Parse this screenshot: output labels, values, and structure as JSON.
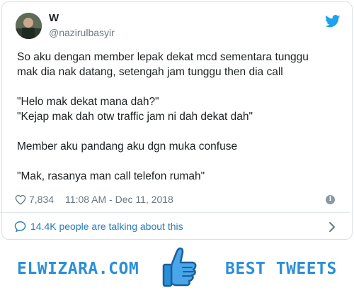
{
  "tweet": {
    "display_name": "W",
    "handle": "@nazirulbasyir",
    "text": "So aku dengan member lepak dekat mcd sementara tunggu\nmak dia nak datang, setengah jam tunggu then dia call\n\n\"Helo mak dekat mana dah?\"\n\"Kejap mak dah otw traffic jam ni dah dekat dah\"\n\nMember aku pandang aku dgn muka confuse\n\n\"Mak, rasanya man call telefon rumah\"",
    "likes": "7,834",
    "timestamp": "11:08 AM - Dec 11, 2018",
    "talking": "14.4K people are talking about this"
  },
  "footer": {
    "brand": "ELWIZARA.COM",
    "tagline": "BEST TWEETS"
  },
  "colors": {
    "twitter_blue": "#1da1f2",
    "link_blue": "#2b7bb9",
    "brand_blue": "#2b8fd8",
    "muted": "#697882"
  },
  "icons": [
    "twitter-bird-icon",
    "heart-icon",
    "info-icon",
    "comment-bubble-icon",
    "chevron-right-icon",
    "thumbs-up-icon"
  ]
}
